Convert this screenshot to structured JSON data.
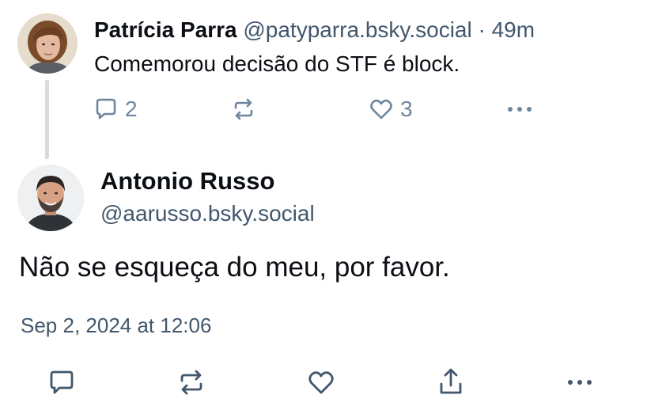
{
  "parent_post": {
    "author_name": "Patrícia Parra",
    "author_handle": "@patyparra.bsky.social",
    "separator": "·",
    "time_ago": "49m",
    "text": "Comemorou decisão do STF é block.",
    "reply_count": "2",
    "like_count": "3"
  },
  "main_post": {
    "author_name": "Antonio Russo",
    "author_handle": "@aarusso.bsky.social",
    "text": "Não se esqueça do meu, por favor.",
    "timestamp": "Sep 2, 2024 at 12:06"
  },
  "colors": {
    "text_primary": "#0b0f14",
    "text_secondary": "#42576c",
    "icon_muted": "#6f869f",
    "thread_line": "#d4dbe2"
  },
  "icons": {
    "reply": "reply-icon",
    "repost": "repost-icon",
    "like": "heart-icon",
    "share": "share-icon",
    "more": "more-icon"
  }
}
